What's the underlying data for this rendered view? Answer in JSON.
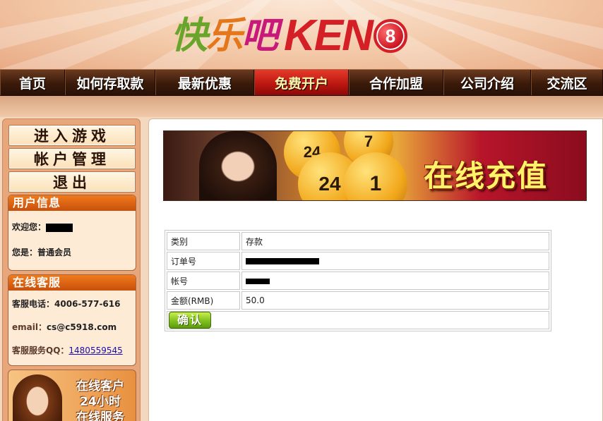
{
  "logo": {
    "cn": [
      "快",
      "乐",
      "吧"
    ],
    "keno": "KEN",
    "ball": "8"
  },
  "nav": {
    "items": [
      "首页",
      "如何存取款",
      "最新优惠",
      "免费开户",
      "合作加盟",
      "公司介绍",
      "交流区"
    ],
    "active_index": 3
  },
  "sidebar": {
    "buttons": [
      "进入游戏",
      "帐户管理",
      "退出"
    ],
    "user_info": {
      "title": "用户信息",
      "welcome_label": "欢迎您：",
      "role_label": "您是：",
      "role_value": "普通会员"
    },
    "service": {
      "title": "在线客服",
      "phone_label": "客服电话：",
      "phone": "4006-577-616",
      "email_label": "email：",
      "email": "cs@c5918.com",
      "qq_label": "客服服务QQ：",
      "qq": "1480559545"
    },
    "promo": {
      "line1": "在线客户",
      "line2": "24小时",
      "line3": "在线服务"
    }
  },
  "main": {
    "banner_title": "在线充值",
    "banner_balls": [
      "24",
      "24",
      "7",
      "1"
    ],
    "form": {
      "rows": [
        {
          "label": "类别",
          "value": "存款"
        },
        {
          "label": "订单号",
          "value": ""
        },
        {
          "label": "帐号",
          "value": ""
        },
        {
          "label": "金额(RMB)",
          "value": "50.0"
        }
      ],
      "confirm_label": "确认"
    }
  },
  "colors": {
    "nav_active": "#c8190f",
    "box_header": "#e8670f",
    "confirm_green": "#7fc11e",
    "logo_green": "#6aa52b",
    "logo_orange": "#e4771c",
    "logo_magenta": "#c8197a",
    "keno_red": "#d51f26"
  }
}
